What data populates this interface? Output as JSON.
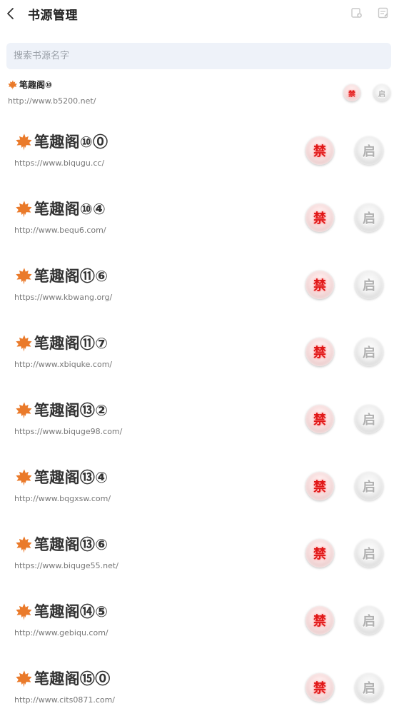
{
  "header": {
    "title": "书源管理",
    "back_icon": "chevron-left-icon",
    "icons": [
      "import-source-icon",
      "edit-note-icon"
    ]
  },
  "search": {
    "placeholder": "搜索书源名字",
    "value": ""
  },
  "first_source": {
    "name": "笔趣阁⑩",
    "url": "http://www.b5200.net/",
    "ban_label": "禁",
    "enable_label": "启"
  },
  "sources": [
    {
      "name": "笔趣阁⑩⓪",
      "url": "https://www.biqugu.cc/",
      "ban_label": "禁",
      "enable_label": "启"
    },
    {
      "name": "笔趣阁⑩④",
      "url": "http://www.bequ6.com/",
      "ban_label": "禁",
      "enable_label": "启"
    },
    {
      "name": "笔趣阁⑪⑥",
      "url": "https://www.kbwang.org/",
      "ban_label": "禁",
      "enable_label": "启"
    },
    {
      "name": "笔趣阁⑪⑦",
      "url": "http://www.xbiquke.com/",
      "ban_label": "禁",
      "enable_label": "启"
    },
    {
      "name": "笔趣阁⑬②",
      "url": "https://www.biquge98.com/",
      "ban_label": "禁",
      "enable_label": "启"
    },
    {
      "name": "笔趣阁⑬④",
      "url": "http://www.bqgxsw.com/",
      "ban_label": "禁",
      "enable_label": "启"
    },
    {
      "name": "笔趣阁⑬⑥",
      "url": "https://www.biquge55.net/",
      "ban_label": "禁",
      "enable_label": "启"
    },
    {
      "name": "笔趣阁⑭⑤",
      "url": "http://www.gebiqu.com/",
      "ban_label": "禁",
      "enable_label": "启"
    },
    {
      "name": "笔趣阁⑮⓪",
      "url": "http://www.cits0871.com/",
      "ban_label": "禁",
      "enable_label": "启"
    }
  ],
  "colors": {
    "ban_text": "#e01818",
    "enable_text": "#b0b0b0",
    "search_bg": "#eef2f9",
    "leaf": "#e8732a"
  }
}
